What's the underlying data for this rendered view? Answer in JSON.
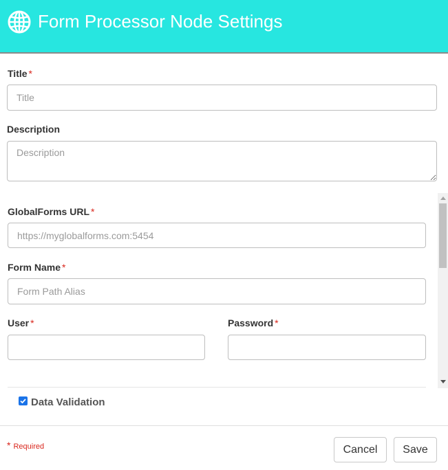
{
  "header": {
    "title": "Form Processor Node Settings",
    "icon": "globe-icon"
  },
  "fields": {
    "title": {
      "label": "Title",
      "placeholder": "Title",
      "value": ""
    },
    "description": {
      "label": "Description",
      "placeholder": "Description",
      "value": ""
    },
    "globalforms_url": {
      "label": "GlobalForms URL",
      "placeholder": "https://myglobalforms.com:5454",
      "value": ""
    },
    "form_name": {
      "label": "Form Name",
      "placeholder": "Form Path Alias",
      "value": ""
    },
    "user": {
      "label": "User",
      "placeholder": "",
      "value": ""
    },
    "password": {
      "label": "Password",
      "placeholder": "",
      "value": ""
    }
  },
  "required_marker": "*",
  "data_validation": {
    "label": "Data Validation",
    "checked": true
  },
  "footer": {
    "required_note": "Required",
    "cancel_label": "Cancel",
    "save_label": "Save"
  },
  "colors": {
    "header_bg": "#27e6e0",
    "required": "#d9261c",
    "checkbox": "#1a73e8"
  }
}
